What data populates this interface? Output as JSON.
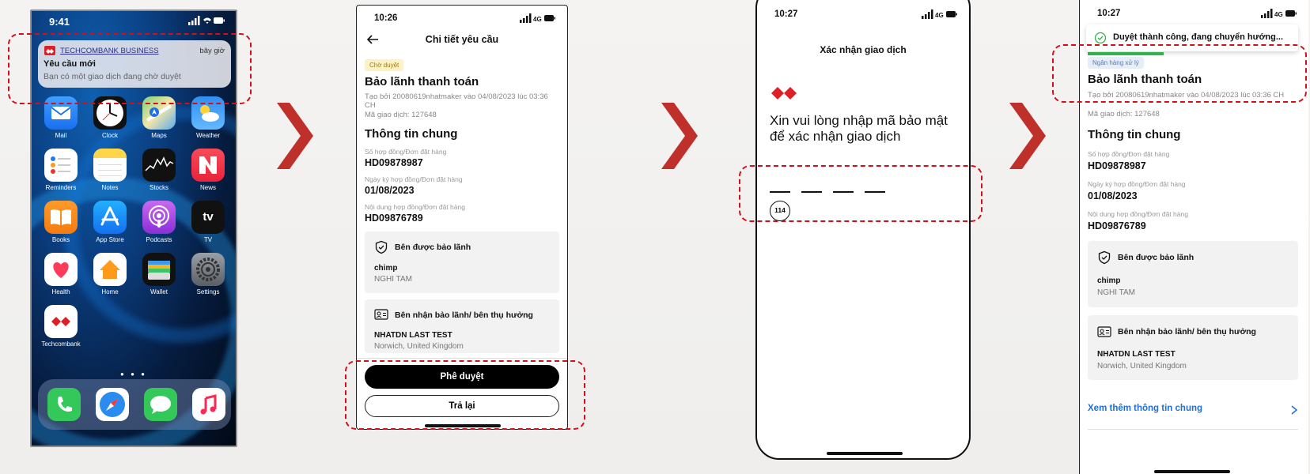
{
  "colors": {
    "accent_red": "#d0111b",
    "tcb_red": "#e01e26",
    "primary_blue": "#1f6fd6",
    "badge_yellow": "#fff2c2",
    "success_green": "#2fb34a"
  },
  "phone1": {
    "time": "9:41",
    "notification": {
      "app_name": "TECHCOMBANK BUSINESS",
      "when": "bây giờ",
      "title": "Yêu cầu mới",
      "body": "Bạn có một giao dịch đang chờ duyệt"
    },
    "apps": [
      {
        "label": "Mail",
        "icon": "mail-icon"
      },
      {
        "label": "Clock",
        "icon": "clock-icon"
      },
      {
        "label": "Maps",
        "icon": "maps-icon"
      },
      {
        "label": "Weather",
        "icon": "weather-icon"
      },
      {
        "label": "Reminders",
        "icon": "reminders-icon"
      },
      {
        "label": "Notes",
        "icon": "notes-icon"
      },
      {
        "label": "Stocks",
        "icon": "stocks-icon"
      },
      {
        "label": "News",
        "icon": "news-icon"
      },
      {
        "label": "Books",
        "icon": "books-icon"
      },
      {
        "label": "App Store",
        "icon": "app-store-icon"
      },
      {
        "label": "Podcasts",
        "icon": "podcasts-icon"
      },
      {
        "label": "TV",
        "icon": "tv-icon"
      },
      {
        "label": "Health",
        "icon": "health-icon"
      },
      {
        "label": "Home",
        "icon": "home-icon"
      },
      {
        "label": "Wallet",
        "icon": "wallet-icon"
      },
      {
        "label": "Settings",
        "icon": "settings-icon"
      },
      {
        "label": "Techcombank",
        "icon": "techcombank-icon"
      }
    ],
    "dock": [
      "phone-icon",
      "safari-icon",
      "messages-icon",
      "music-icon"
    ],
    "tv_text": "tv"
  },
  "phone2": {
    "time": "10:26",
    "network": "4G",
    "header_title": "Chi tiết yêu cầu",
    "status_badge": "Chờ duyệt",
    "title": "Bảo lãnh thanh toán",
    "created_by": "Tạo bởi 20080619nhatmaker vào 04/08/2023 lúc 03:36 CH",
    "transaction_code": "Mã giao dịch: 127648",
    "section_title": "Thông tin chung",
    "fields": [
      {
        "label": "Số hợp đồng/Đơn đặt hàng",
        "value": "HD09878987"
      },
      {
        "label": "Ngày ký hợp đồng/Đơn đặt hàng",
        "value": "01/08/2023"
      },
      {
        "label": "Nội dung hợp đồng/Đơn đặt hàng",
        "value": "HD09876789"
      }
    ],
    "guaranteed_party": {
      "title": "Bên được bảo lãnh",
      "name": "chimp",
      "sub": "NGHI TAM"
    },
    "beneficiary": {
      "title": "Bên nhận bảo lãnh/ bên thụ hưởng",
      "name": "NHATDN LAST TEST",
      "sub": "Norwich, United Kingdom"
    },
    "approve_label": "Phê duyệt",
    "return_label": "Trả lại"
  },
  "phone3": {
    "time": "10:27",
    "network": "4G",
    "header_title": "Xác nhận giao dịch",
    "prompt": "Xin vui lòng nhập mã bảo mật để xác nhận giao dịch",
    "timer": "114"
  },
  "phone4": {
    "time": "10:27",
    "network": "4G",
    "toast": "Duyệt thành công, đang chuyển hướng...",
    "status_badge": "Ngân hàng xử lý",
    "title": "Bảo lãnh thanh toán",
    "created_by": "Tạo bởi 20080619nhatmaker vào 04/08/2023 lúc 03:36 CH",
    "transaction_code": "Mã giao dịch: 127648",
    "section_title": "Thông tin chung",
    "fields": [
      {
        "label": "Số hợp đồng/Đơn đặt hàng",
        "value": "HD09878987"
      },
      {
        "label": "Ngày ký hợp đồng/Đơn đặt hàng",
        "value": "01/08/2023"
      },
      {
        "label": "Nội dung hợp đồng/Đơn đặt hàng",
        "value": "HD09876789"
      }
    ],
    "guaranteed_party": {
      "title": "Bên được bảo lãnh",
      "name": "chimp",
      "sub": "NGHI TAM"
    },
    "beneficiary": {
      "title": "Bên nhận bảo lãnh/ bên thụ hưởng",
      "name": "NHATDN LAST TEST",
      "sub": "Norwich, United Kingdom"
    },
    "more_link": "Xem thêm thông tin chung"
  }
}
